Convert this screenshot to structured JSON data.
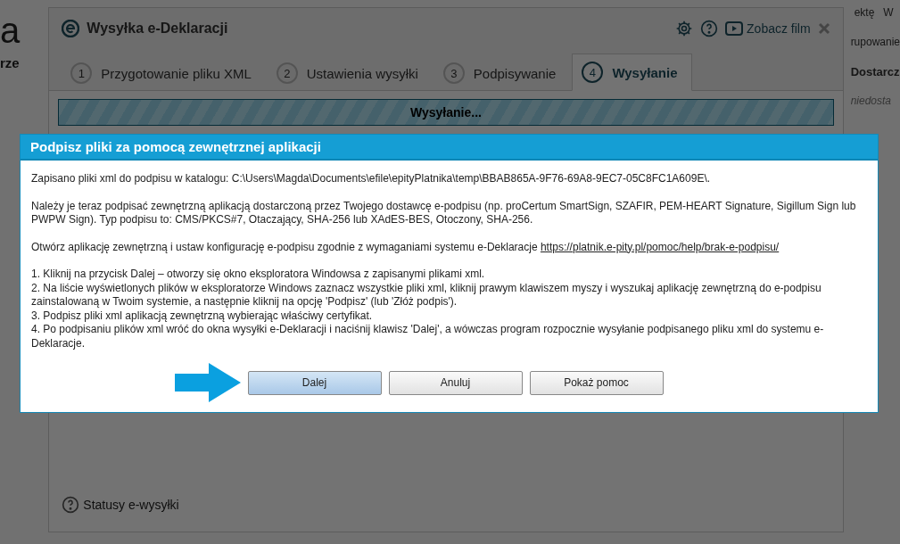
{
  "background_app": {
    "left_fragments": [
      "a",
      "rze"
    ],
    "top_right": [
      "ektę",
      "W"
    ],
    "right_fragments": [
      {
        "text": "rupowanie",
        "kind": "plain"
      },
      {
        "text": "Dostarcz",
        "kind": "bold"
      },
      {
        "text": "niedosta",
        "kind": "italic"
      }
    ]
  },
  "window": {
    "title": "Wysyłka e-Deklaracji",
    "video_link": "Zobacz film",
    "tabs": [
      {
        "number": "1",
        "label": "Przygotowanie pliku XML",
        "selected": false
      },
      {
        "number": "2",
        "label": "Ustawienia wysyłki",
        "selected": false
      },
      {
        "number": "3",
        "label": "Podpisywanie",
        "selected": false
      },
      {
        "number": "4",
        "label": "Wysyłanie",
        "selected": true
      }
    ],
    "progress": {
      "label": "Wysyłanie...",
      "level": 1
    },
    "footer_link": "Statusy e-wysyłki"
  },
  "dialog": {
    "title": "Podpisz pliki za pomocą zewnętrznej aplikacji",
    "paragraphs": [
      {
        "text": "Zapisano pliki xml do podpisu w katalogu: C:\\Users\\Magda\\Documents\\efile\\epityPlatnika\\temp\\BBAB865A-9F76-69A8-9EC7-05C8FC1A609E\\."
      },
      {
        "text": "Należy je teraz podpisać zewnętrzną aplikacją dostarczoną przez Twojego dostawcę e-podpisu (np. proCertum SmartSign, SZAFIR, PEM-HEART Signature, Sigillum Sign lub PWPW Sign). Typ podpisu to: CMS/PKCS#7, Otaczający, SHA-256 lub XAdES-BES, Otoczony, SHA-256."
      },
      {
        "text": "Otwórz aplikację zewnętrzną i ustaw konfigurację e-podpisu zgodnie z wymaganiami systemu e-Deklaracje",
        "link": "https://platnik.e-pity.pl/pomoc/help/brak-e-podpisu/"
      }
    ],
    "steps": [
      "1. Kliknij na przycisk Dalej – otworzy się okno eksploratora Windowsa z zapisanymi plikami xml.",
      "2. Na liście wyświetlonych plików w eksploratorze Windows zaznacz wszystkie pliki xml, kliknij prawym klawiszem myszy i wyszukaj aplikację zewnętrzną do e-podpisu zainstalowaną w Twoim systemie, a następnie kliknij na opcję 'Podpisz' (lub 'Złóż podpis').",
      "3. Podpisz pliki xml aplikacją zewnętrzną wybierając właściwy certyfikat.",
      "4. Po podpisaniu plików xml wróć do okna wysyłki e-Deklaracji i naciśnij klawisz 'Dalej', a wówczas program rozpocznie wysyłanie podpisanego pliku xml do systemu  e-Deklaracje."
    ],
    "buttons": [
      {
        "label": "Dalej",
        "kind": "primary"
      },
      {
        "label": "Anuluj",
        "kind": "default"
      },
      {
        "label": "Pokaż pomoc",
        "kind": "default"
      }
    ]
  }
}
